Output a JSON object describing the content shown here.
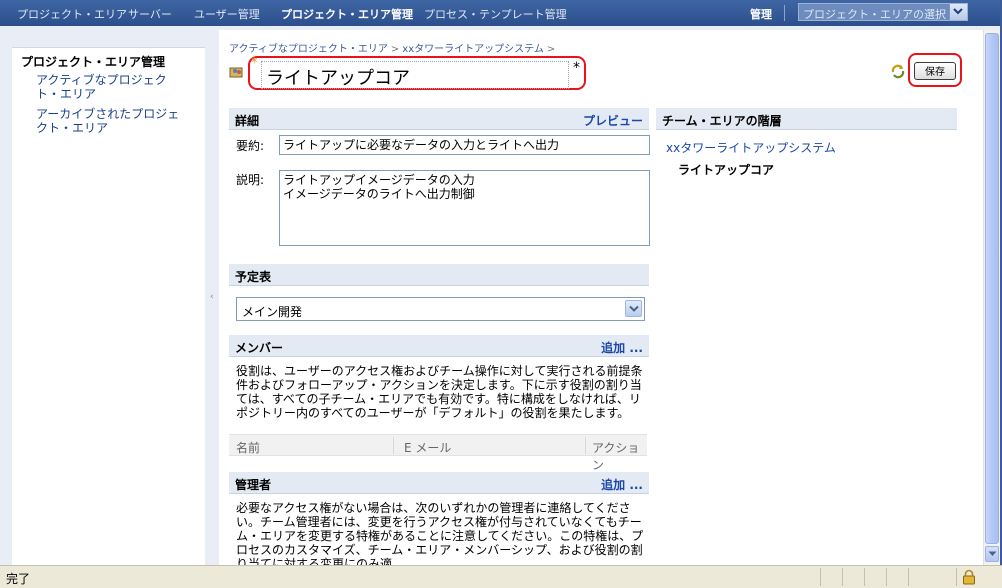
{
  "topnav": {
    "items": [
      "プロジェクト・エリア",
      "サーバー",
      "ユーザー管理",
      "プロジェクト・エリア管理",
      "プロセス・テンプレート管理"
    ],
    "admin": "管理",
    "selector_placeholder": "プロジェクト・エリアの選択"
  },
  "leftnav": {
    "heading": "プロジェクト・エリア管理",
    "links": [
      "アクティブなプロジェクト・エリア",
      "アーカイブされたプロジェクト・エリア"
    ]
  },
  "breadcrumb": [
    "アクティブなプロジェクト・エリア",
    "xxタワーライトアップシステム"
  ],
  "title": {
    "required_mark": "*",
    "value": "ライトアップコア",
    "star": "*"
  },
  "save_label": "保存",
  "details": {
    "heading": "詳細",
    "preview": "プレビュー",
    "summary_label": "要約:",
    "summary_value": "ライトアップに必要なデータの入力とライトへ出力",
    "description_label": "説明:",
    "description_value": "ライトアップイメージデータの入力\nイメージデータのライトへ出力制御"
  },
  "schedule": {
    "heading": "予定表",
    "selected": "メイン開発"
  },
  "members": {
    "heading": "メンバー",
    "add": "追加 ...",
    "text": "役割は、ユーザーのアクセス権およびチーム操作に対して実行される前提条件およびフォローアップ・アクションを決定します。下に示す役割の割り当ては、すべての子チーム・エリアでも有効です。特に構成をしなければ、リポジトリー内のすべてのユーザーが「デフォルト」の役割を果たします。",
    "columns": [
      "名前",
      "E メール",
      "アクション"
    ]
  },
  "admins": {
    "heading": "管理者",
    "add": "追加 ...",
    "text": "必要なアクセス権がない場合は、次のいずれかの管理者に連絡してください。チーム管理者には、変更を行うアクセス権が付与されていなくてもチーム・エリアを変更する特権があることに注意してください。この特権は、プロセスのカスタマイズ、チーム・エリア・メンバーシップ、および役割の割り当てに対する変更にのみ適"
  },
  "team_hierarchy": {
    "heading": "チーム・エリアの階層",
    "parent": "xxタワーライトアップシステム",
    "current": "ライトアップコア"
  },
  "status": {
    "text": "完了"
  }
}
